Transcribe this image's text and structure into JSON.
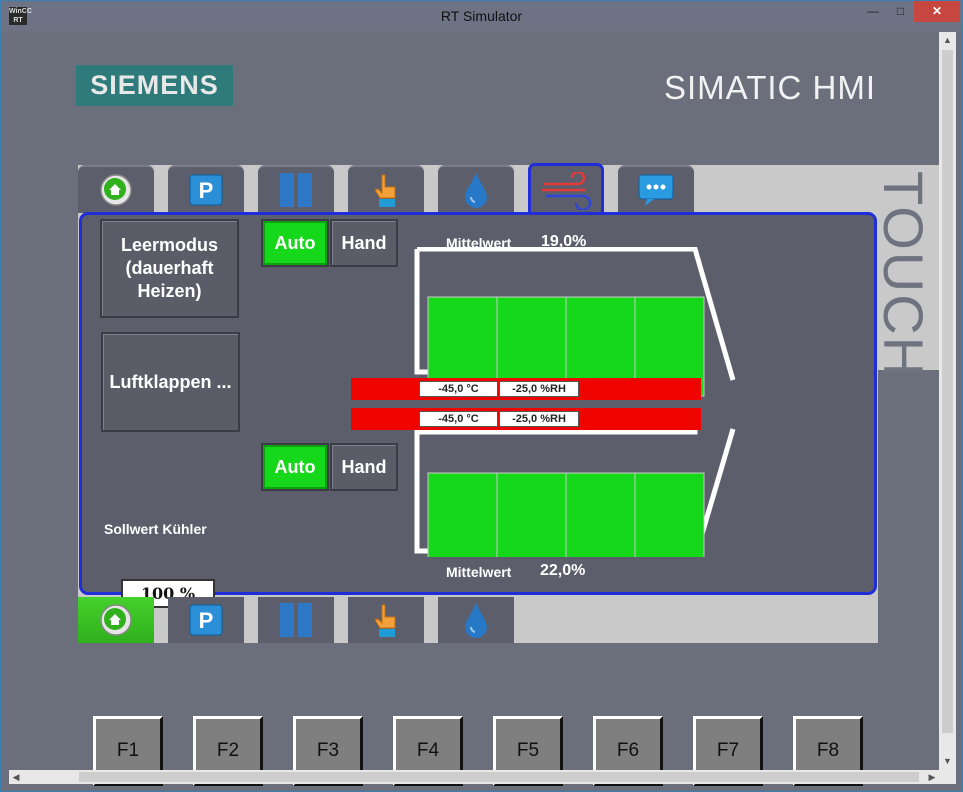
{
  "window": {
    "title": "RT Simulator",
    "icon_label": "WinCC RT"
  },
  "header": {
    "logo": "SIEMENS",
    "product": "SIMATIC HMI",
    "side_label": "TOUCH"
  },
  "tabs_top": [
    "home-icon",
    "parameter-icon",
    "pause-icon",
    "hand-icon",
    "water-drop-icon",
    "air-flow-icon",
    "chat-icon"
  ],
  "tabs_bottom": [
    "home-icon",
    "parameter-icon",
    "pause-icon",
    "hand-icon",
    "water-drop-icon"
  ],
  "left": {
    "leermodus_label": "Leermodus (dauerhaft Heizen)",
    "luftklappen_label": "Luftklappen ...",
    "setpoint_label": "Sollwert Kühler",
    "setpoint_value": "100 %"
  },
  "upper": {
    "auto_label": "Auto",
    "hand_label": "Hand",
    "mean_label": "Mittelwert",
    "mean_value": "19,0%",
    "flaps_fill_fraction": 1.0
  },
  "lower": {
    "auto_label": "Auto",
    "hand_label": "Hand",
    "mean_label": "Mittelwert",
    "mean_value": "22,0%",
    "flaps_fill_fraction": 1.0
  },
  "sensor_rows": [
    {
      "temperature": "-45,0 °C",
      "humidity": "-25,0 %RH"
    },
    {
      "temperature": "-45,0 °C",
      "humidity": "-25,0 %RH"
    }
  ],
  "function_keys": [
    "F1",
    "F2",
    "F3",
    "F4",
    "F5",
    "F6",
    "F7",
    "F8"
  ],
  "colors": {
    "active_green": "#16d81a",
    "alarm_red": "#f00400",
    "frame_blue": "#1f2ed9",
    "logo_teal": "#2f7b7b"
  }
}
